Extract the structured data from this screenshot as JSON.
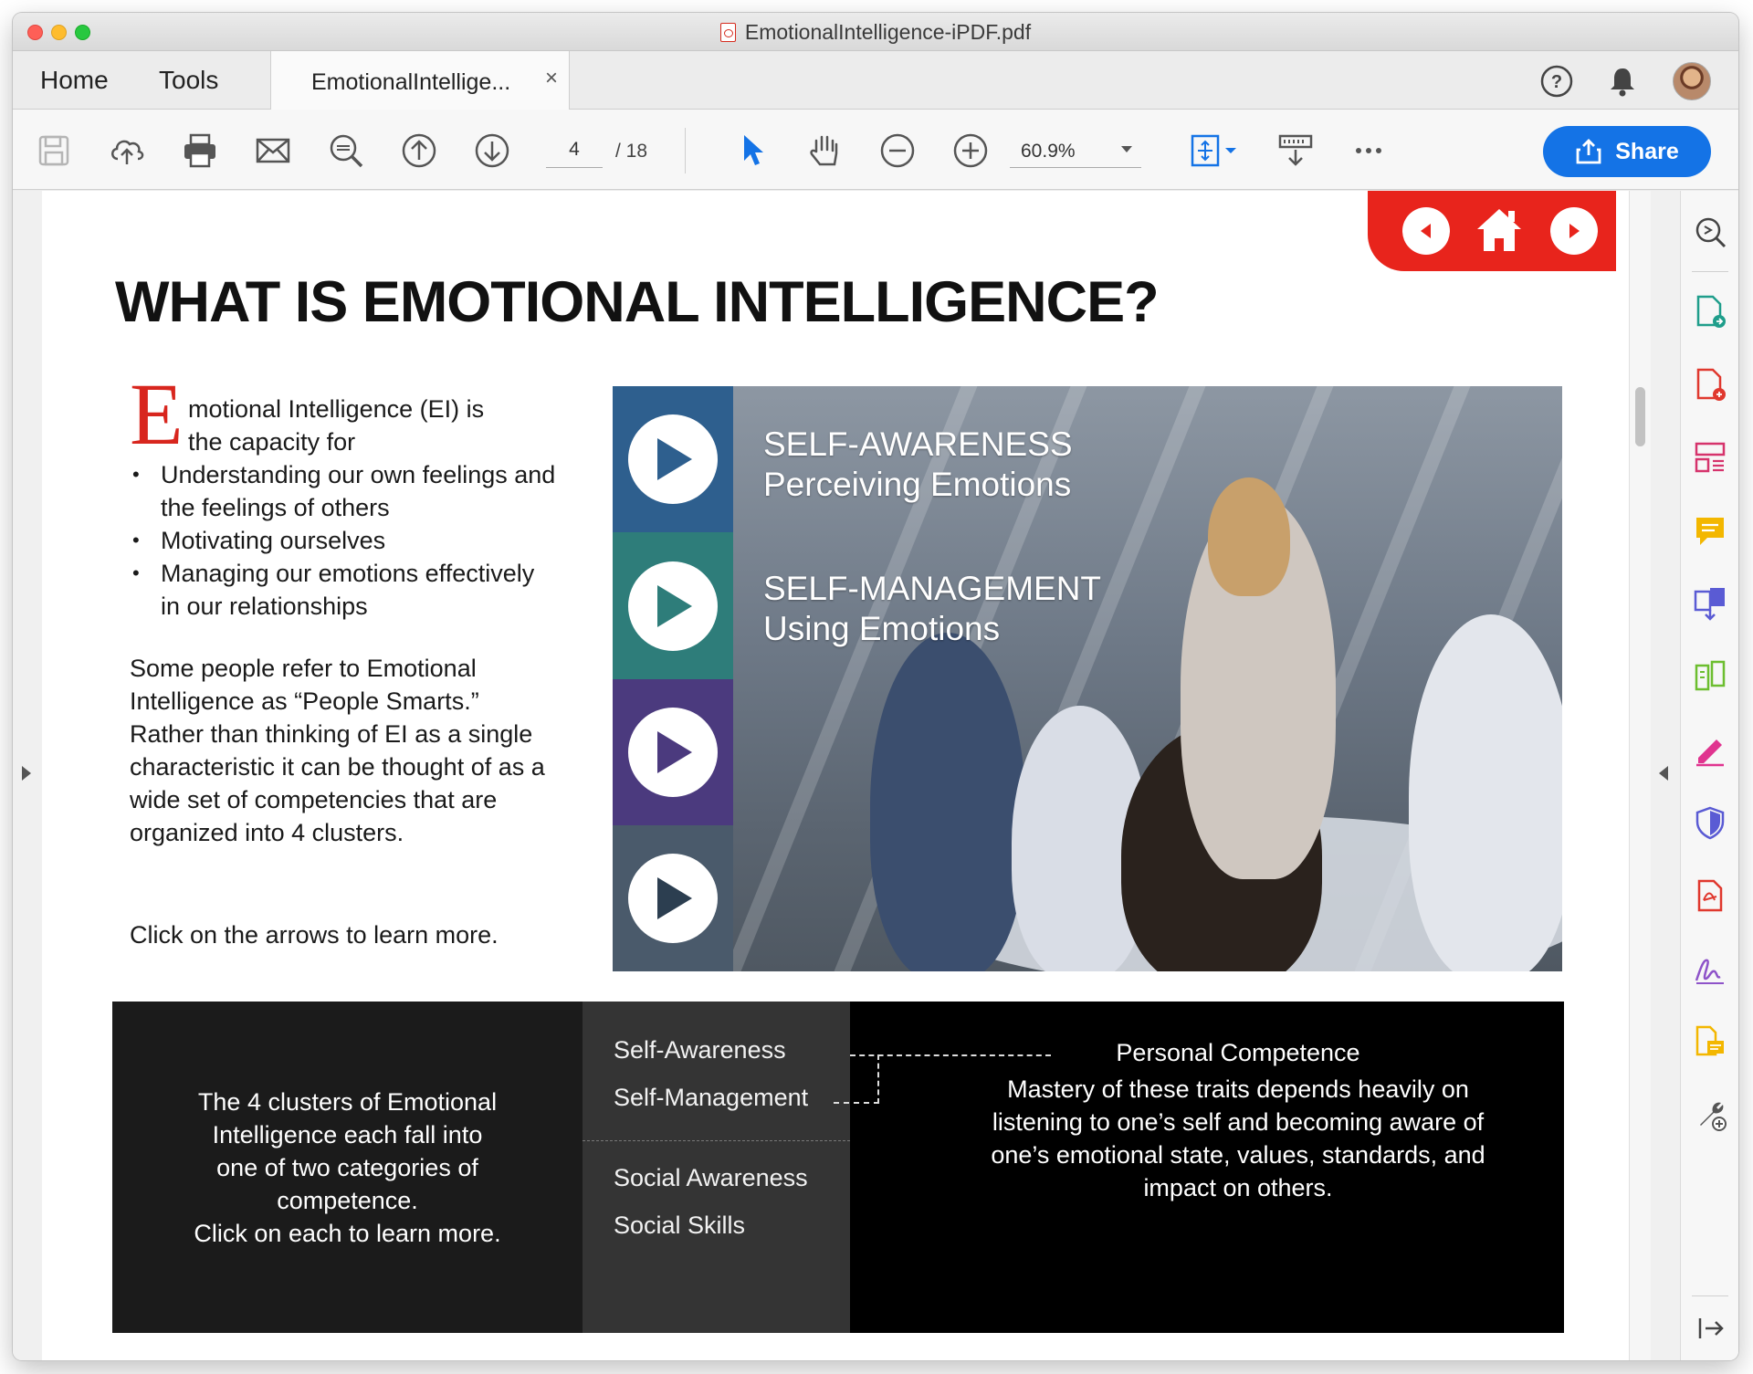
{
  "window": {
    "title": "EmotionalIntelligence-iPDF.pdf"
  },
  "tabs": {
    "home": "Home",
    "tools": "Tools",
    "document": "EmotionalIntellige...",
    "close": "×"
  },
  "toolbar": {
    "page_current": "4",
    "page_total": "/ 18",
    "zoom": "60.9%",
    "share_label": "Share"
  },
  "page": {
    "title": "WHAT IS EMOTIONAL INTELLIGENCE?",
    "intro": {
      "dropcap": "E",
      "line1": "motional Intelligence (EI) is",
      "line2": "the capacity for",
      "bullets": [
        "Understanding our own feelings and the feelings of others",
        "Motivating ourselves",
        "Managing our emotions effectively in our relationships"
      ]
    },
    "paragraph": "Some people refer to Emotional Intelligence as “People Smarts.” Rather than thinking of EI as a single characteristic it can be thought of as a wide set of competencies that are organized into 4 clusters.",
    "click_note": "Click on the arrows to learn more.",
    "media": {
      "tiles": [
        {
          "color": "#2e5f8e",
          "arrow": "#2e5f8e"
        },
        {
          "color": "#2e7d7a",
          "arrow": "#2e7d7a"
        },
        {
          "color": "#4b3a7e",
          "arrow": "#4b3a7e"
        },
        {
          "color": "#4a5a6b",
          "arrow": "#2c3e50"
        }
      ],
      "labels": [
        {
          "heading": "SELF-AWARENESS",
          "sub": "Perceiving Emotions"
        },
        {
          "heading": "SELF-MANAGEMENT",
          "sub": "Using Emotions"
        }
      ]
    },
    "clusters_box": {
      "left_lines": [
        "The 4 clusters of Emotional",
        "Intelligence each fall into",
        "one of two categories of",
        "competence.",
        "Click on each to learn more."
      ],
      "clusters": [
        "Self-Awareness",
        "Self-Management",
        "Social Awareness",
        "Social Skills"
      ],
      "competence_title": "Personal Competence",
      "competence_lines": [
        "Mastery of these traits depends heavily on",
        "listening to one’s self and becoming aware of",
        "one’s emotional state, values, standards, and",
        "impact on others."
      ]
    }
  },
  "colors": {
    "accent_red": "#e8241c",
    "share_blue": "#1473e6"
  },
  "icons": {
    "toolbar": [
      "save-icon",
      "upload-icon",
      "print-icon",
      "email-icon",
      "find-icon",
      "page-up-icon",
      "page-down-icon",
      "select-cursor-icon",
      "hand-icon",
      "zoom-out-icon",
      "zoom-in-icon",
      "fit-page-icon",
      "scroll-mode-icon",
      "more-icon"
    ],
    "right_panel": [
      "search-zoom-icon",
      "export-pdf-icon",
      "create-pdf-icon",
      "organize-pages-icon",
      "comment-icon",
      "combine-files-icon",
      "compare-icon",
      "fill-sign-icon",
      "protect-icon",
      "pdf-file-icon",
      "signature-icon",
      "send-review-icon",
      "more-tools-icon",
      "collapse-panel-icon"
    ]
  }
}
